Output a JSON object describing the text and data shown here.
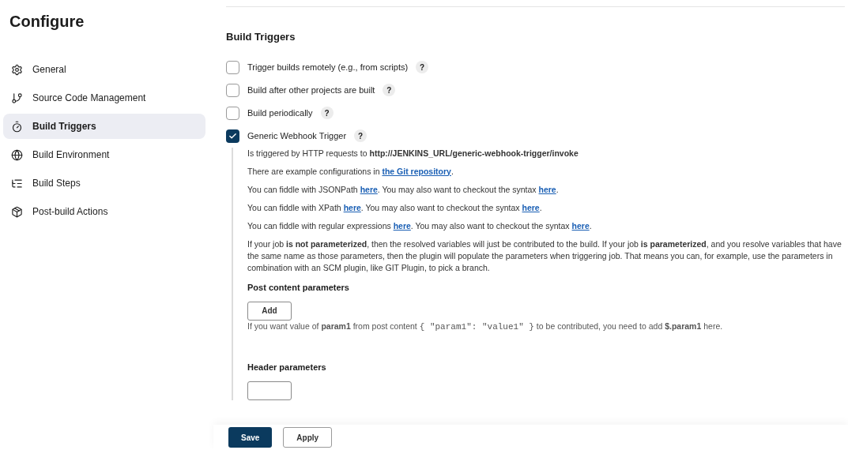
{
  "title": "Configure",
  "sidebar": {
    "items": [
      {
        "kind": "gear",
        "label": "General",
        "selected": false
      },
      {
        "kind": "branch",
        "label": "Source Code Management",
        "selected": false
      },
      {
        "kind": "timer",
        "label": "Build Triggers",
        "selected": true
      },
      {
        "kind": "globe",
        "label": "Build Environment",
        "selected": false
      },
      {
        "kind": "list",
        "label": "Build Steps",
        "selected": false
      },
      {
        "kind": "box",
        "label": "Post-build Actions",
        "selected": false
      }
    ]
  },
  "section": {
    "title": "Build Triggers",
    "triggers": [
      {
        "label": "Trigger builds remotely (e.g., from scripts)",
        "help": "?",
        "checked": false
      },
      {
        "label": "Build after other projects are built",
        "help": "?",
        "checked": false
      },
      {
        "label": "Build periodically",
        "help": "?",
        "checked": false
      },
      {
        "label": "Generic Webhook Trigger",
        "help": "?",
        "checked": true
      }
    ],
    "details": [
      [
        {
          "kind": "text",
          "text": "Is triggered by HTTP requests to **http://JENKINS_URL/generic-webhook-trigger/invoke**"
        }
      ],
      [
        {
          "kind": "text",
          "text": "There are example configurations in "
        },
        {
          "kind": "link",
          "text": "the Git repository"
        },
        {
          "kind": "text",
          "text": "."
        }
      ],
      [
        {
          "kind": "text",
          "text": "You can fiddle with JSONPath "
        },
        {
          "kind": "link",
          "text": "here"
        },
        {
          "kind": "text",
          "text": ". You may also want to checkout the syntax "
        },
        {
          "kind": "link",
          "text": "here"
        },
        {
          "kind": "text",
          "text": "."
        }
      ],
      [
        {
          "kind": "text",
          "text": "You can fiddle with XPath "
        },
        {
          "kind": "link",
          "text": "here"
        },
        {
          "kind": "text",
          "text": ". You may also want to checkout the syntax "
        },
        {
          "kind": "link",
          "text": "here"
        },
        {
          "kind": "text",
          "text": "."
        }
      ],
      [
        {
          "kind": "text",
          "text": "You can fiddle with regular expressions "
        },
        {
          "kind": "link",
          "text": "here"
        },
        {
          "kind": "text",
          "text": ". You may also want to checkout the syntax "
        },
        {
          "kind": "link",
          "text": "here"
        },
        {
          "kind": "text",
          "text": "."
        }
      ],
      [
        {
          "kind": "text",
          "text": "If your job **is not parameterized**, then the resolved variables will just be contributed to the build. If your job **is parameterized**, and you resolve variables that have the same name as those parameters, then the plugin will populate the parameters when triggering job. That means you can, for example, use the parameters in combination with an SCM plugin, like GIT Plugin, to pick a branch."
        }
      ]
    ],
    "post_content": {
      "title": "Post content parameters",
      "button": "Add",
      "hint": [
        {
          "kind": "text",
          "text": "If you want value of **param1** from post content "
        },
        {
          "kind": "code",
          "text": "{ \"param1\": \"value1\" }"
        },
        {
          "kind": "text",
          "text": " to be contributed, you need to add **$.param1** here."
        }
      ]
    },
    "header": {
      "title": "Header parameters"
    }
  },
  "footer": {
    "buttons": [
      {
        "label": "Save",
        "kind": "primary"
      },
      {
        "label": "Apply",
        "kind": "secondary"
      }
    ]
  }
}
